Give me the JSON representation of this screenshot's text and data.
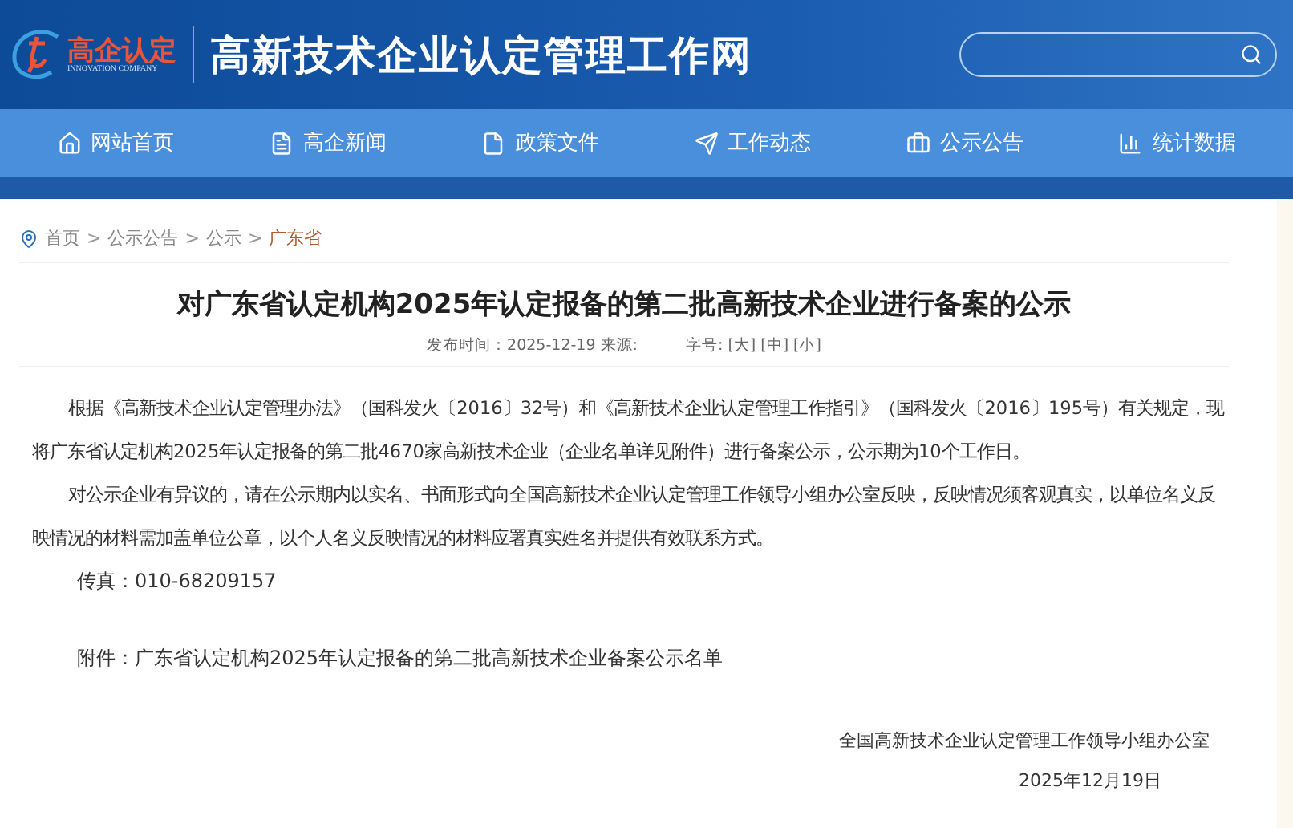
{
  "header": {
    "logo_text": "高企认定",
    "logo_subtext": "INNOVATION COMPANY",
    "site_title": "高新技术企业认定管理工作网"
  },
  "nav": [
    {
      "label": "网站首页",
      "kind": "home"
    },
    {
      "label": "高企新闻",
      "kind": "news"
    },
    {
      "label": "政策文件",
      "kind": "file"
    },
    {
      "label": "工作动态",
      "kind": "send"
    },
    {
      "label": "公示公告",
      "kind": "notice"
    },
    {
      "label": "统计数据",
      "kind": "chart"
    }
  ],
  "breadcrumb": {
    "separator": ">",
    "items": [
      "首页",
      "公示公告",
      "公示",
      "广东省"
    ]
  },
  "article": {
    "title": "对广东省认定机构2025年认定报备的第二批高新技术企业进行备案的公示",
    "meta": {
      "published": "发布时间：2025-12-19 来源:",
      "font_size_label": "字号:",
      "font_sizes": [
        "[大]",
        "[中]",
        "[小]"
      ]
    },
    "paragraphs": [
      "根据《高新技术企业认定管理办法》（国科发火〔2016〕32号）和《高新技术企业认定管理工作指引》（国科发火〔2016〕195号）有关规定，现将广东省认定机构2025年认定报备的第二批4670家高新技术企业（企业名单详见附件）进行备案公示，公示期为10个工作日。",
      "对公示企业有异议的，请在公示期内以实名、书面形式向全国高新技术企业认定管理工作领导小组办公室反映，反映情况须客观真实，以单位名义反映情况的材料需加盖单位公章，以个人名义反映情况的材料应署真实姓名并提供有效联系方式。"
    ],
    "fax": "传真：010-68209157",
    "attachment_label": "附件：",
    "attachment_link": "广东省认定机构2025年认定报备的第二批高新技术企业备案公示名单",
    "signature": "全国高新技术企业认定管理工作领导小组办公室",
    "date": "2025年12月19日"
  }
}
